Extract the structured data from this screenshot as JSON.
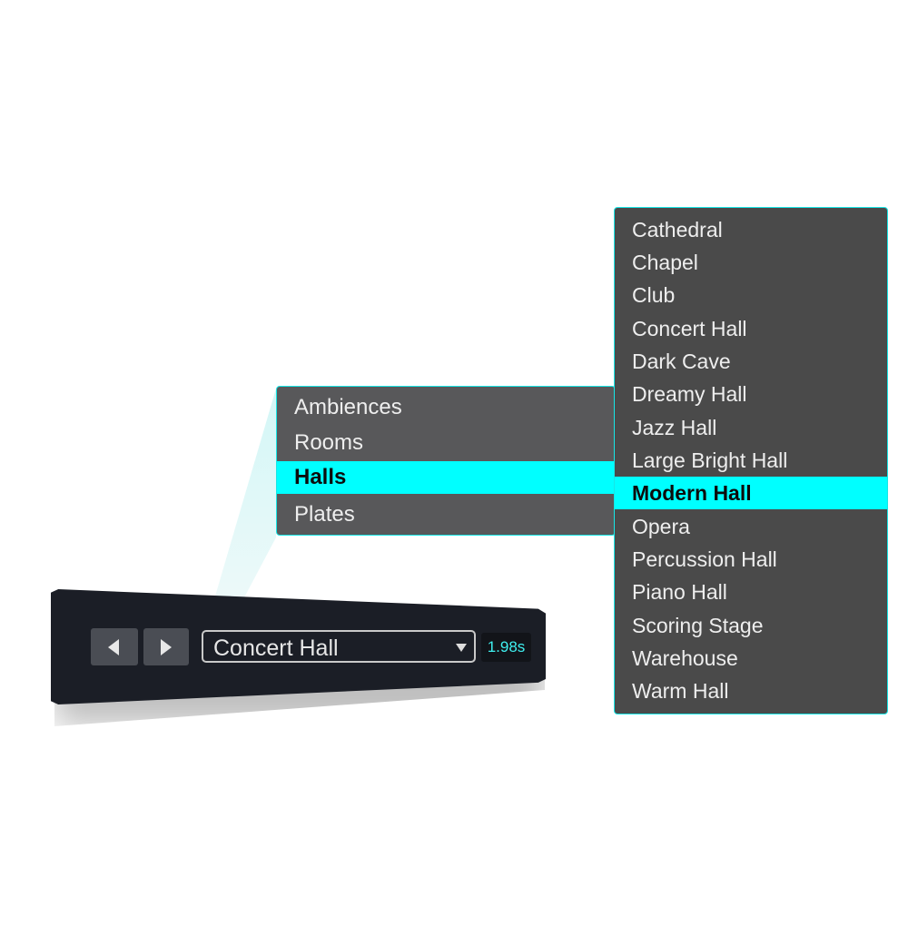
{
  "accent_color": "#00ffff",
  "preset_bar": {
    "prev_icon": "triangle-left-icon",
    "next_icon": "triangle-right-icon",
    "selected_preset": "Concert Hall",
    "dropdown_icon": "triangle-down-icon",
    "decay_time": "1.98s"
  },
  "category_menu": {
    "items": [
      "Ambiences",
      "Rooms",
      "Halls",
      "Plates"
    ],
    "selected": "Halls"
  },
  "preset_menu": {
    "items": [
      "Cathedral",
      "Chapel",
      "Club",
      "Concert Hall",
      "Dark Cave",
      "Dreamy Hall",
      "Jazz Hall",
      "Large Bright Hall",
      "Modern Hall",
      "Opera",
      "Percussion Hall",
      "Piano Hall",
      "Scoring Stage",
      "Warehouse",
      "Warm Hall"
    ],
    "selected": "Modern Hall"
  }
}
